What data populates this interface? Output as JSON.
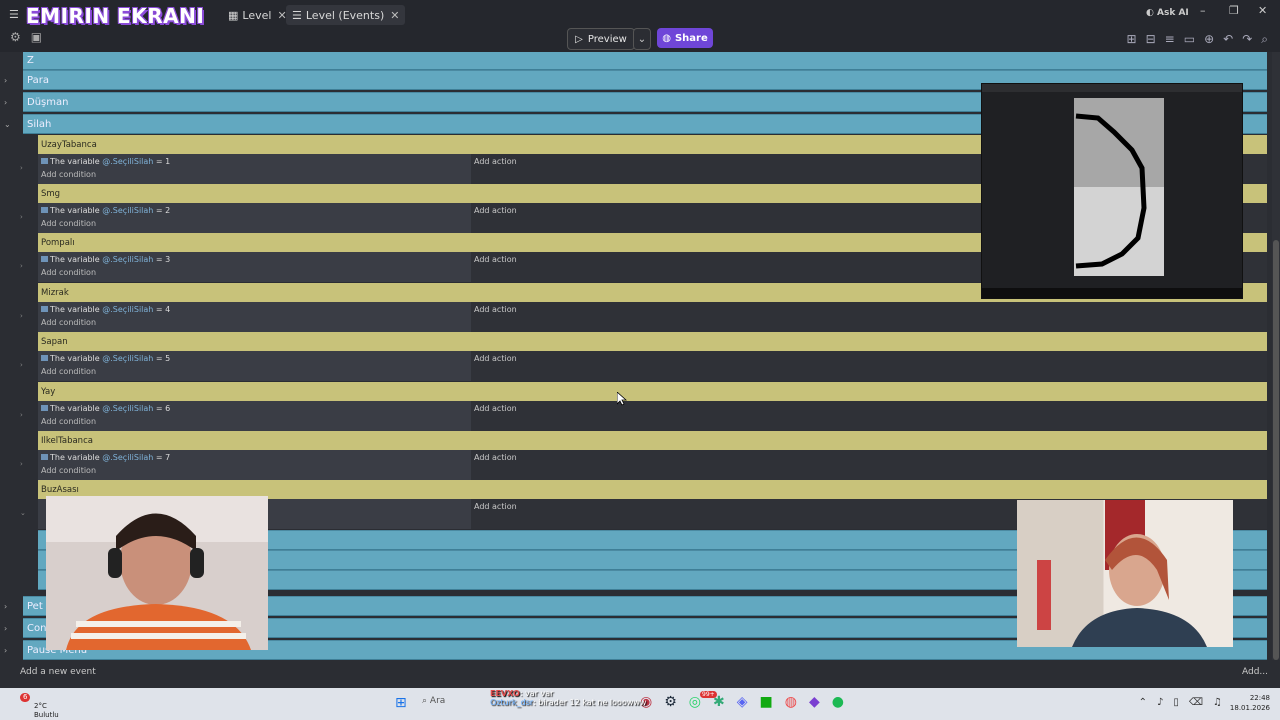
{
  "window": {
    "stream_title": "EMIRIN EKRANI",
    "tabs": [
      {
        "label": "Level"
      },
      {
        "label": "Level (Events)"
      }
    ],
    "ask_ai": "Ask AI"
  },
  "toolbar": {
    "preview": "Preview",
    "share": "Share"
  },
  "groups_top": [
    {
      "label": "Z"
    },
    {
      "label": "Para"
    },
    {
      "label": "Düşman"
    },
    {
      "label": "Silah"
    }
  ],
  "events": [
    {
      "name": "UzayTabanca",
      "cond_text": "The variable",
      "var": "@.SeçiliSilah",
      "op": "=",
      "val": "1",
      "add_condition": "Add condition",
      "add_action": "Add action"
    },
    {
      "name": "Smg",
      "cond_text": "The variable",
      "var": "@.SeçiliSilah",
      "op": "=",
      "val": "2",
      "add_condition": "Add condition",
      "add_action": "Add action"
    },
    {
      "name": "Pompalı",
      "cond_text": "The variable",
      "var": "@.SeçiliSilah",
      "op": "=",
      "val": "3",
      "add_condition": "Add condition",
      "add_action": "Add action"
    },
    {
      "name": "Mizrak",
      "cond_text": "The variable",
      "var": "@.SeçiliSilah",
      "op": "=",
      "val": "4",
      "add_condition": "Add condition",
      "add_action": "Add action"
    },
    {
      "name": "Sapan",
      "cond_text": "The variable",
      "var": "@.SeçiliSilah",
      "op": "=",
      "val": "5",
      "add_condition": "Add condition",
      "add_action": "Add action"
    },
    {
      "name": "Yay",
      "cond_text": "The variable",
      "var": "@.SeçiliSilah",
      "op": "=",
      "val": "6",
      "add_condition": "Add condition",
      "add_action": "Add action"
    },
    {
      "name": "IlkelTabanca",
      "cond_text": "The variable",
      "var": "@.SeçiliSilah",
      "op": "=",
      "val": "7",
      "add_condition": "Add condition",
      "add_action": "Add action"
    },
    {
      "name": "BuzAsası",
      "cond_text": "",
      "var": "",
      "op": "",
      "val": "",
      "add_condition": "",
      "add_action": "Add action"
    }
  ],
  "groups_bottom": [
    {
      "label": "Pet"
    },
    {
      "label": "Con"
    },
    {
      "label": "Pause Menu"
    }
  ],
  "footer": {
    "add_event": "Add a new event",
    "add_right": "Add..."
  },
  "taskbar": {
    "badge_count": "6",
    "temperature": "2°C",
    "weather": "Bulutlu",
    "search_placeholder": "Ara",
    "chat_user1": "EEVXO",
    "chat_msg1": ": var var",
    "chat_user2": "Ozturk_dsr",
    "chat_msg2": ": birader 12 kat ne looowww",
    "notif_badge": "99+",
    "time": "22:48",
    "date": "18.01.2026"
  },
  "colors": {
    "group_blue": "#62a8c0",
    "event_yellow": "#c8c27a",
    "share_purple": "#6f46d8"
  }
}
